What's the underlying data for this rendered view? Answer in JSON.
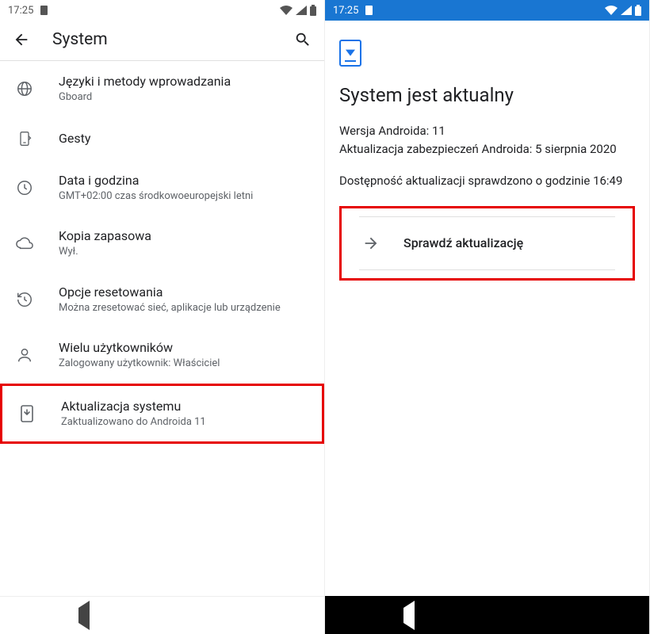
{
  "status": {
    "time": "17:25"
  },
  "left": {
    "headerTitle": "System",
    "items": [
      {
        "title": "Języki i metody wprowadzania",
        "sub": "Gboard"
      },
      {
        "title": "Gesty",
        "sub": ""
      },
      {
        "title": "Data i godzina",
        "sub": "GMT+02:00 czas środkowoeuropejski letni"
      },
      {
        "title": "Kopia zapasowa",
        "sub": "Wył."
      },
      {
        "title": "Opcje resetowania",
        "sub": "Można zresetować sieć, aplikacje lub urządzenie"
      },
      {
        "title": "Wielu użytkowników",
        "sub": "Zalogowany użytkownik: Właściciel"
      },
      {
        "title": "Aktualizacja systemu",
        "sub": "Zaktualizowano do Androida 11"
      }
    ]
  },
  "right": {
    "title": "System jest aktualny",
    "versionLine": "Wersja Androida: 11",
    "securityLine": "Aktualizacja zabezpieczeń Androida: 5 sierpnia 2020",
    "checkedLine": "Dostępność aktualizacji sprawdzono o godzinie 16:49",
    "checkLabel": "Sprawdź aktualizację"
  }
}
